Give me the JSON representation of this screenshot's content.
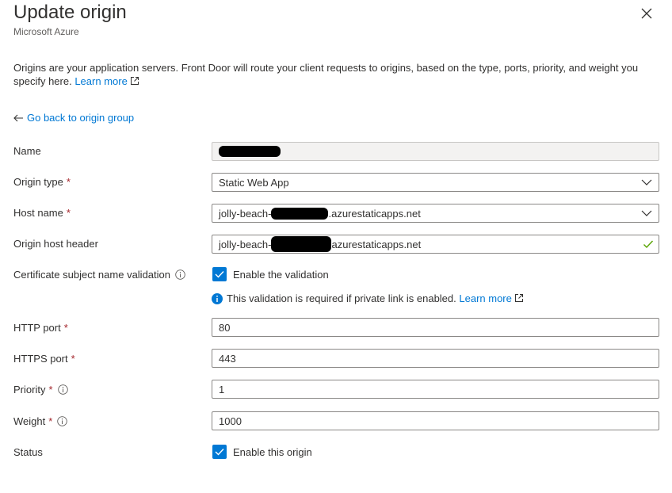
{
  "header": {
    "title": "Update origin",
    "subtitle": "Microsoft Azure"
  },
  "description": {
    "text": "Origins are your application servers. Front Door will route your client requests to origins, based on the type, ports, priority, and weight you specify here.",
    "learn_more": "Learn more"
  },
  "back_link": "Go back to origin group",
  "form": {
    "name": {
      "label": "Name",
      "value": ""
    },
    "origin_type": {
      "label": "Origin type",
      "value": "Static Web App"
    },
    "host_name": {
      "label": "Host name",
      "prefix": "jolly-beach-",
      "suffix": ".azurestaticapps.net"
    },
    "origin_host_header": {
      "label": "Origin host header",
      "prefix": "jolly-beach-",
      "suffix": "azurestaticapps.net"
    },
    "cert_validation": {
      "label": "Certificate subject name validation",
      "checkbox_label": "Enable the validation",
      "checked": true,
      "note": "This validation is required if private link is enabled.",
      "note_link": "Learn more"
    },
    "http_port": {
      "label": "HTTP port",
      "value": "80"
    },
    "https_port": {
      "label": "HTTPS port",
      "value": "443"
    },
    "priority": {
      "label": "Priority",
      "value": "1"
    },
    "weight": {
      "label": "Weight",
      "value": "1000"
    },
    "status": {
      "label": "Status",
      "checkbox_label": "Enable this origin",
      "checked": true
    }
  },
  "required_marker": "*",
  "colors": {
    "accent": "#0078d4",
    "required": "#a4262c",
    "success": "#57a300"
  },
  "icons": {
    "close": "close-icon",
    "back": "arrow-left-icon",
    "info": "info-icon",
    "external": "external-link-icon",
    "chevron": "chevron-down-icon",
    "check": "checkmark-icon"
  }
}
